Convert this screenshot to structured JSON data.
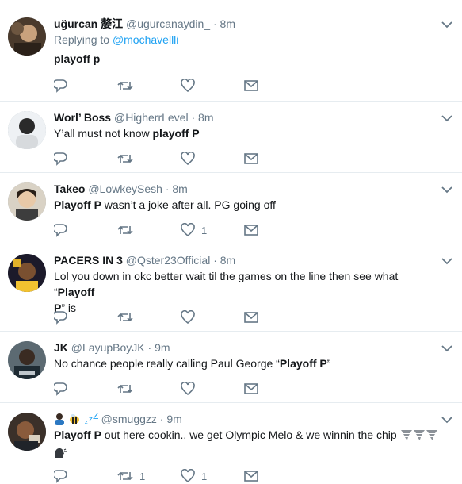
{
  "tweets": [
    {
      "name": "uğurcan 嫠江",
      "handle": "@ugurcanaydin_",
      "time": "8m",
      "replying_prefix": "Replying to",
      "replying_to": "@mochavellli",
      "text_bold": "playoff p",
      "text_rest": "",
      "retweets": "",
      "likes": ""
    },
    {
      "name": "Worl’ Boss",
      "handle": "@HigherrLevel",
      "time": "8m",
      "text_pre": "Y’all must not know ",
      "text_bold": "playoff P",
      "retweets": "",
      "likes": ""
    },
    {
      "name": "Takeo",
      "handle": "@LowkeySesh",
      "time": "8m",
      "text_bold": "Playoff P",
      "text_rest": " wasn’t a joke after all. PG going off",
      "retweets": "",
      "likes": "1"
    },
    {
      "name": "PACERS IN 3",
      "handle": "@Qster23Official",
      "time": "8m",
      "text_pre": "Lol you down in okc better wait til the games on the line then see what “",
      "text_bold1": "Playoff",
      "text_bold2": "P",
      "text_rest": "” is",
      "retweets": "",
      "likes": ""
    },
    {
      "name": "JK",
      "handle": "@LayupBoyJK",
      "time": "9m",
      "text_pre": "No chance people really calling Paul George “",
      "text_bold": "Playoff P",
      "text_rest": "”",
      "retweets": "",
      "likes": ""
    },
    {
      "name": "",
      "handle": "@smuggzz",
      "time": "9m",
      "text_bold": "Playoff P",
      "text_rest": " out here cookin.. we get Olympic Melo & we winnin the chip",
      "retweets": "1",
      "likes": "1"
    }
  ],
  "separator": "·",
  "icons": [
    "reply-icon",
    "retweet-icon",
    "like-icon",
    "dm-icon",
    "caret-down-icon"
  ],
  "colors": {
    "accent": "#1da1f2",
    "secondary": "#657786",
    "border": "#e6ecf0",
    "icon": "#657786"
  }
}
